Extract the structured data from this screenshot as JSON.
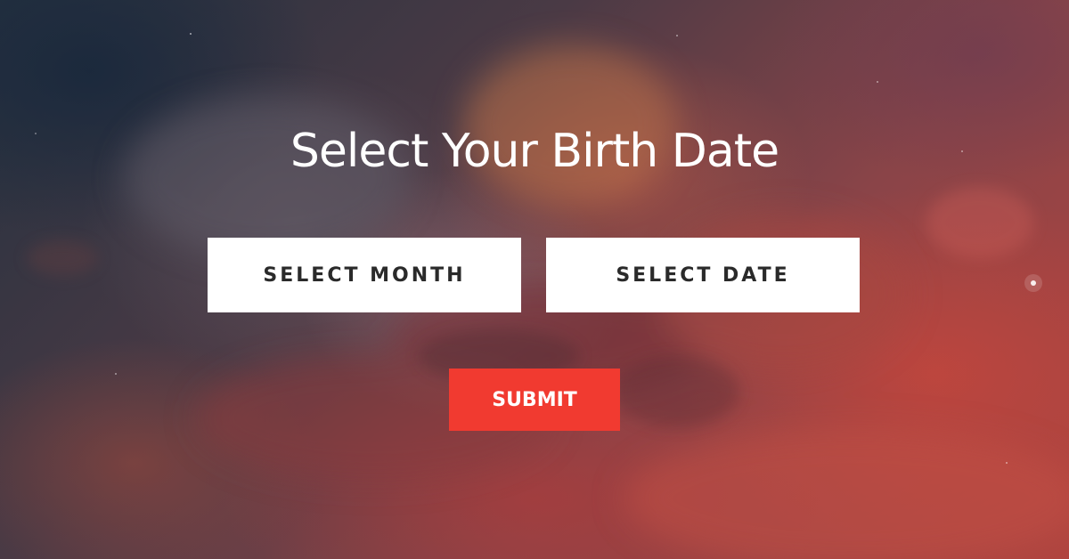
{
  "page": {
    "title": "Select Your Birth Date"
  },
  "form": {
    "month_label": "SELECT MONTH",
    "date_label": "SELECT DATE",
    "submit_label": "SUBMIT"
  },
  "colors": {
    "accent": "#f13a30",
    "select_bg": "#ffffff",
    "select_text": "#2a2a2a",
    "title_text": "#ffffff"
  }
}
